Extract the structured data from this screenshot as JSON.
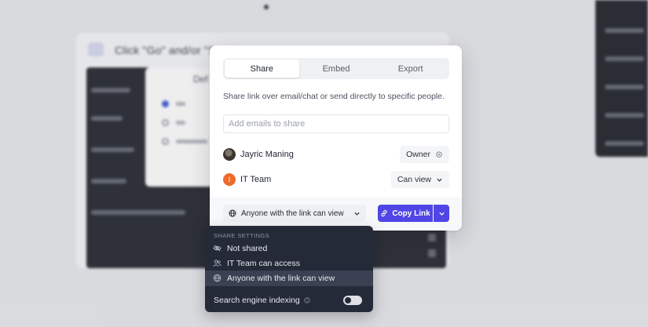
{
  "background": {
    "doc_title": "Click \"Go\" and/or \"Save\""
  },
  "dialog": {
    "tabs": [
      {
        "label": "Share",
        "active": true
      },
      {
        "label": "Embed",
        "active": false
      },
      {
        "label": "Export",
        "active": false
      }
    ],
    "description": "Share link over email/chat or send directly to specific people.",
    "email_placeholder": "Add emails to share",
    "members": [
      {
        "name": "Jayric Maning",
        "role": "Owner",
        "avatar": "photo-avatar"
      },
      {
        "name": "IT Team",
        "role": "Can view",
        "avatar_letter": "I"
      }
    ],
    "link_access": "Anyone with the link can view",
    "copy_label": "Copy Link",
    "accent_color": "#4f46e5"
  },
  "share_settings": {
    "heading": "SHARE SETTINGS",
    "options": [
      {
        "label": "Not shared",
        "icon": "eye-off-icon",
        "selected": false
      },
      {
        "label": "IT Team can access",
        "icon": "users-icon",
        "selected": false
      },
      {
        "label": "Anyone with the link can view",
        "icon": "globe-icon",
        "selected": true
      }
    ],
    "indexing_label": "Search engine indexing",
    "indexing_enabled": false
  }
}
